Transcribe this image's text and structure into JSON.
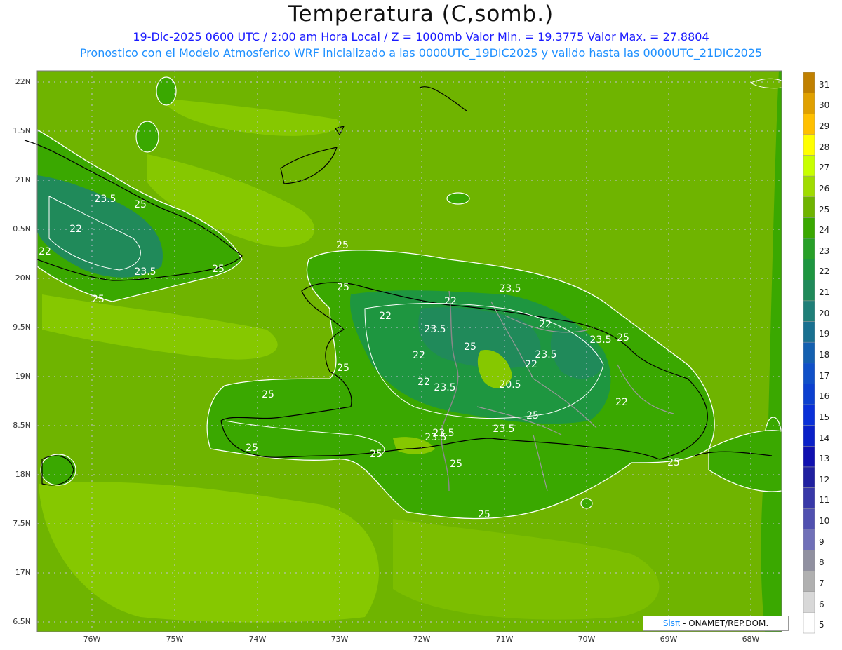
{
  "title": "Temperatura (C,somb.)",
  "subtitle1": "19-Dic-2025  0600 UTC / 2:00 am Hora Local / Z = 1000mb   Valor Min. = 19.3775  Valor Max. = 27.8804",
  "subtitle2": "Pronostico con el Modelo Atmosferico WRF inicializado a las 0000UTC_19DIC2025 y valido hasta las  0000UTC_21DIC2025",
  "credit": {
    "brand": "Sisπ",
    "text": " - ONAMET/REP.DOM."
  },
  "lat_labels": [
    "22N",
    "1.5N",
    "21N",
    "0.5N",
    "20N",
    "9.5N",
    "19N",
    "8.5N",
    "18N",
    "7.5N",
    "17N",
    "6.5N"
  ],
  "lon_labels": [
    "76W",
    "75W",
    "74W",
    "73W",
    "72W",
    "71W",
    "70W",
    "69W",
    "68W"
  ],
  "colorbar": {
    "labels": [
      "31",
      "30",
      "29",
      "28",
      "27",
      "26",
      "25",
      "24",
      "23",
      "22",
      "21",
      "20",
      "19",
      "18",
      "17",
      "16",
      "15",
      "14",
      "13",
      "12",
      "11",
      "10",
      "9",
      "8",
      "7",
      "6",
      "5"
    ],
    "colors": [
      "#c08000",
      "#e0a000",
      "#ffc000",
      "#ffff00",
      "#c8ff00",
      "#a0dc00",
      "#6fb400",
      "#3aa800",
      "#28a028",
      "#1e9640",
      "#208a5a",
      "#1f7f78",
      "#197090",
      "#1460b0",
      "#1050c8",
      "#0c40d0",
      "#0a30d8",
      "#0a20c8",
      "#1010b0",
      "#2020a0",
      "#3838a8",
      "#5050b0",
      "#7070b8",
      "#9090a0",
      "#b0b0b0",
      "#d8d8d8",
      "#ffffff"
    ]
  },
  "contour_labels": [
    "23.5",
    "25",
    "22",
    "22",
    "25",
    "23.5",
    "25",
    "25",
    "22",
    "23.5",
    "22",
    "22",
    "23.5",
    "22",
    "23.5",
    "25",
    "22",
    "25",
    "23.5",
    "22",
    "20.5",
    "23.5",
    "25",
    "22",
    "25",
    "25",
    "23.5",
    "23.5",
    "23.5",
    "25",
    "25",
    "25",
    "25",
    "25",
    "25"
  ],
  "colors": {
    "ocean": "#6fb400",
    "ocean_light": "#86c800",
    "land_mid": "#3aa800",
    "land_high": "#1e9640",
    "land_cool": "#208a5a",
    "contour": "#ffffff",
    "coast": "#000000",
    "border": "#888888"
  }
}
